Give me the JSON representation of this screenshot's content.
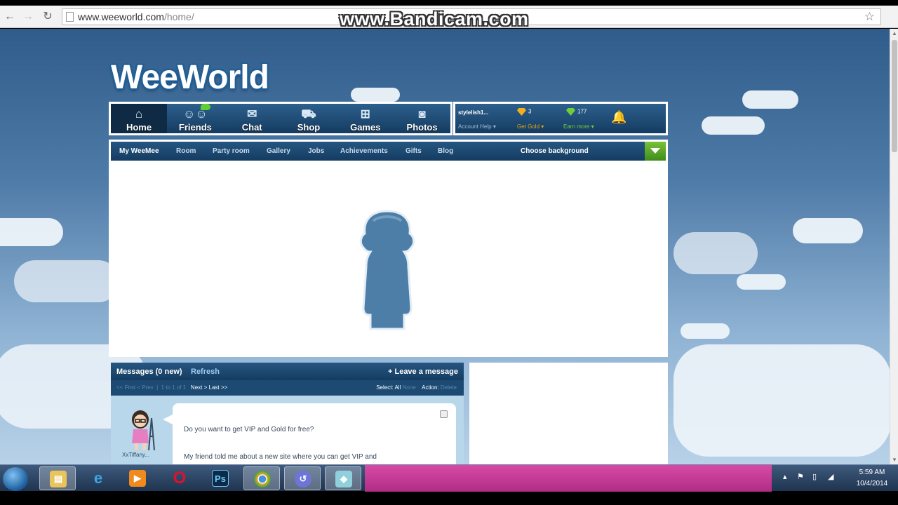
{
  "browser": {
    "url_host": "www.weeworld.com",
    "url_path": "/home/",
    "watermark": "www.Bandicam.com"
  },
  "logo": {
    "text": "WeeWorld"
  },
  "main_nav": [
    {
      "label": "Home",
      "icon": "home-icon"
    },
    {
      "label": "Friends",
      "icon": "friends-icon"
    },
    {
      "label": "Chat",
      "icon": "chat-icon"
    },
    {
      "label": "Shop",
      "icon": "shop-icon"
    },
    {
      "label": "Games",
      "icon": "games-icon"
    },
    {
      "label": "Photos",
      "icon": "photos-icon"
    }
  ],
  "user": {
    "name": "stylelish1...",
    "account_link": "Account Help",
    "gold_count": "3",
    "gold_link": "Get Gold",
    "gems_count": "177",
    "gems_link": "Earn more"
  },
  "sub_nav": {
    "items": [
      "My WeeMee",
      "Room",
      "Party room",
      "Gallery",
      "Jobs",
      "Achievements",
      "Gifts",
      "Blog"
    ],
    "background_select": "Choose background"
  },
  "messages": {
    "title": "Messages (0 new)",
    "refresh": "Refresh",
    "leave": "+ Leave a message",
    "pager_prev": "<< First < Prev",
    "pager_range": "1 to 1 of 1",
    "pager_next": "Next > Last >>",
    "select_label": "Select:",
    "select_all": "All",
    "select_none": "None",
    "action_label": "Action:",
    "action_delete": "Delete",
    "sender": "XxTiffany...",
    "line1": "Do you want to get VIP and Gold for free?",
    "line2": "My friend told me about a new site where you can get VIP and"
  },
  "taskbar": {
    "time": "5:59 AM",
    "date": "10/4/2014"
  },
  "colors": {
    "nav_dark": "#153c61",
    "nav_light": "#2c5f8c",
    "gold": "#e0a416",
    "green": "#6fcf3b",
    "taskbar_pink": "#c0368f"
  }
}
